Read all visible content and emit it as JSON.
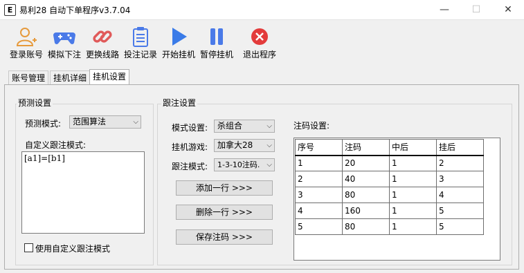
{
  "window": {
    "title": "易利28 自动下单程序v3.7.04",
    "app_icon_letter": "E",
    "min": "—",
    "max": "☐",
    "close": "✕"
  },
  "toolbar": [
    {
      "label": "登录账号",
      "icon": "add-user-icon"
    },
    {
      "label": "模拟下注",
      "icon": "gamepad-icon"
    },
    {
      "label": "更换线路",
      "icon": "link-icon"
    },
    {
      "label": "投注记录",
      "icon": "clipboard-icon"
    },
    {
      "label": "开始挂机",
      "icon": "play-icon"
    },
    {
      "label": "暂停挂机",
      "icon": "pause-icon"
    },
    {
      "label": "退出程序",
      "icon": "close-circle-icon"
    }
  ],
  "tabs": [
    "账号管理",
    "挂机详细",
    "挂机设置"
  ],
  "predict": {
    "group_title": "预测设置",
    "mode_label": "预测模式:",
    "mode_value": "范围算法",
    "custom_label": "自定义跟注模式:",
    "custom_text": "[a1]=[b1]",
    "checkbox_label": "使用自定义跟注模式"
  },
  "follow": {
    "group_title": "跟注设置",
    "mode_label": "模式设置:",
    "mode_value": "杀组合",
    "game_label": "挂机游戏:",
    "game_value": "加拿大28",
    "follow_label": "跟注模式:",
    "follow_value": "1-3-10注码.",
    "add_row": "添加一行 >>>",
    "delete_row": "删除一行 >>>",
    "save_code": "保存注码 >>>",
    "code_label": "注码设置:"
  },
  "table": {
    "headers": [
      "序号",
      "注码",
      "中后",
      "挂后"
    ],
    "rows": [
      [
        "1",
        "20",
        "1",
        "2"
      ],
      [
        "2",
        "40",
        "1",
        "3"
      ],
      [
        "3",
        "80",
        "1",
        "4"
      ],
      [
        "4",
        "160",
        "1",
        "5"
      ],
      [
        "5",
        "80",
        "1",
        "5"
      ]
    ]
  }
}
